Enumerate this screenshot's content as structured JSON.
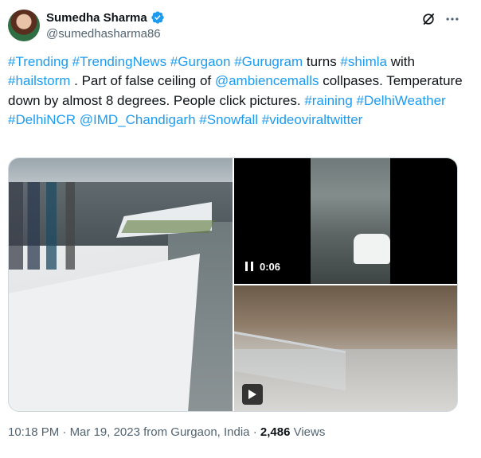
{
  "author": {
    "display_name": "Sumedha Sharma",
    "handle": "@sumedhasharma86",
    "verified_icon": "verified-badge-icon"
  },
  "tweet": {
    "segments": [
      {
        "text": "#Trending",
        "link": true
      },
      {
        "text": " ",
        "link": false
      },
      {
        "text": "#TrendingNews",
        "link": true
      },
      {
        "text": " ",
        "link": false
      },
      {
        "text": "#Gurgaon",
        "link": true
      },
      {
        "text": " ",
        "link": false
      },
      {
        "text": "#Gurugram",
        "link": true
      },
      {
        "text": " turns ",
        "link": false
      },
      {
        "text": "#shimla",
        "link": true
      },
      {
        "text": " with ",
        "link": false
      },
      {
        "text": "#hailstorm",
        "link": true
      },
      {
        "text": " . Part of false ceiling of ",
        "link": false
      },
      {
        "text": "@ambiencemalls",
        "link": true
      },
      {
        "text": " collpases. Temperature down by almost 8 degrees. People click pictures. ",
        "link": false
      },
      {
        "text": "#raining",
        "link": true
      },
      {
        "text": " ",
        "link": false
      },
      {
        "text": "#DelhiWeather",
        "link": true
      },
      {
        "text": " ",
        "link": false
      },
      {
        "text": "#DelhiNCR",
        "link": true
      },
      {
        "text": " ",
        "link": false
      },
      {
        "text": "@IMD_Chandigarh",
        "link": true
      },
      {
        "text": " ",
        "link": false
      },
      {
        "text": "#Snowfall",
        "link": true
      },
      {
        "text": " ",
        "link": false
      },
      {
        "text": "#videoviraltwitter",
        "link": true
      }
    ]
  },
  "media": {
    "video_time": "0:06"
  },
  "meta": {
    "time": "10:18 PM",
    "separator": " · ",
    "date": "Mar 19, 2023",
    "location": " from Gurgaon, India",
    "views_count": "2,486",
    "views_label": " Views"
  },
  "colors": {
    "link": "#1d9bf0",
    "text": "#0f1419",
    "secondary": "#536471"
  }
}
